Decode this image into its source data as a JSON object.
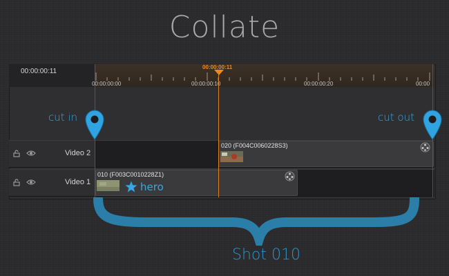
{
  "title": "Collate",
  "timecode": "00:00:00:11",
  "playhead_timecode": "00:00:00:11",
  "ruler_labels": [
    "00:00:00:00",
    "00:00:00:10",
    "00:00:00:20",
    "00:00"
  ],
  "markers": {
    "cut_in_label": "cut in",
    "cut_out_label": "cut out"
  },
  "tracks": [
    {
      "name": "Video 2",
      "clip": "020 (F004C0060228S3)"
    },
    {
      "name": "Video 1",
      "clip": "010 (F003C0010228Z1)"
    }
  ],
  "hero_label": "hero",
  "shot_label": "Shot 010",
  "colors": {
    "accent": "#38a8e0",
    "playhead": "#f08a1c"
  }
}
